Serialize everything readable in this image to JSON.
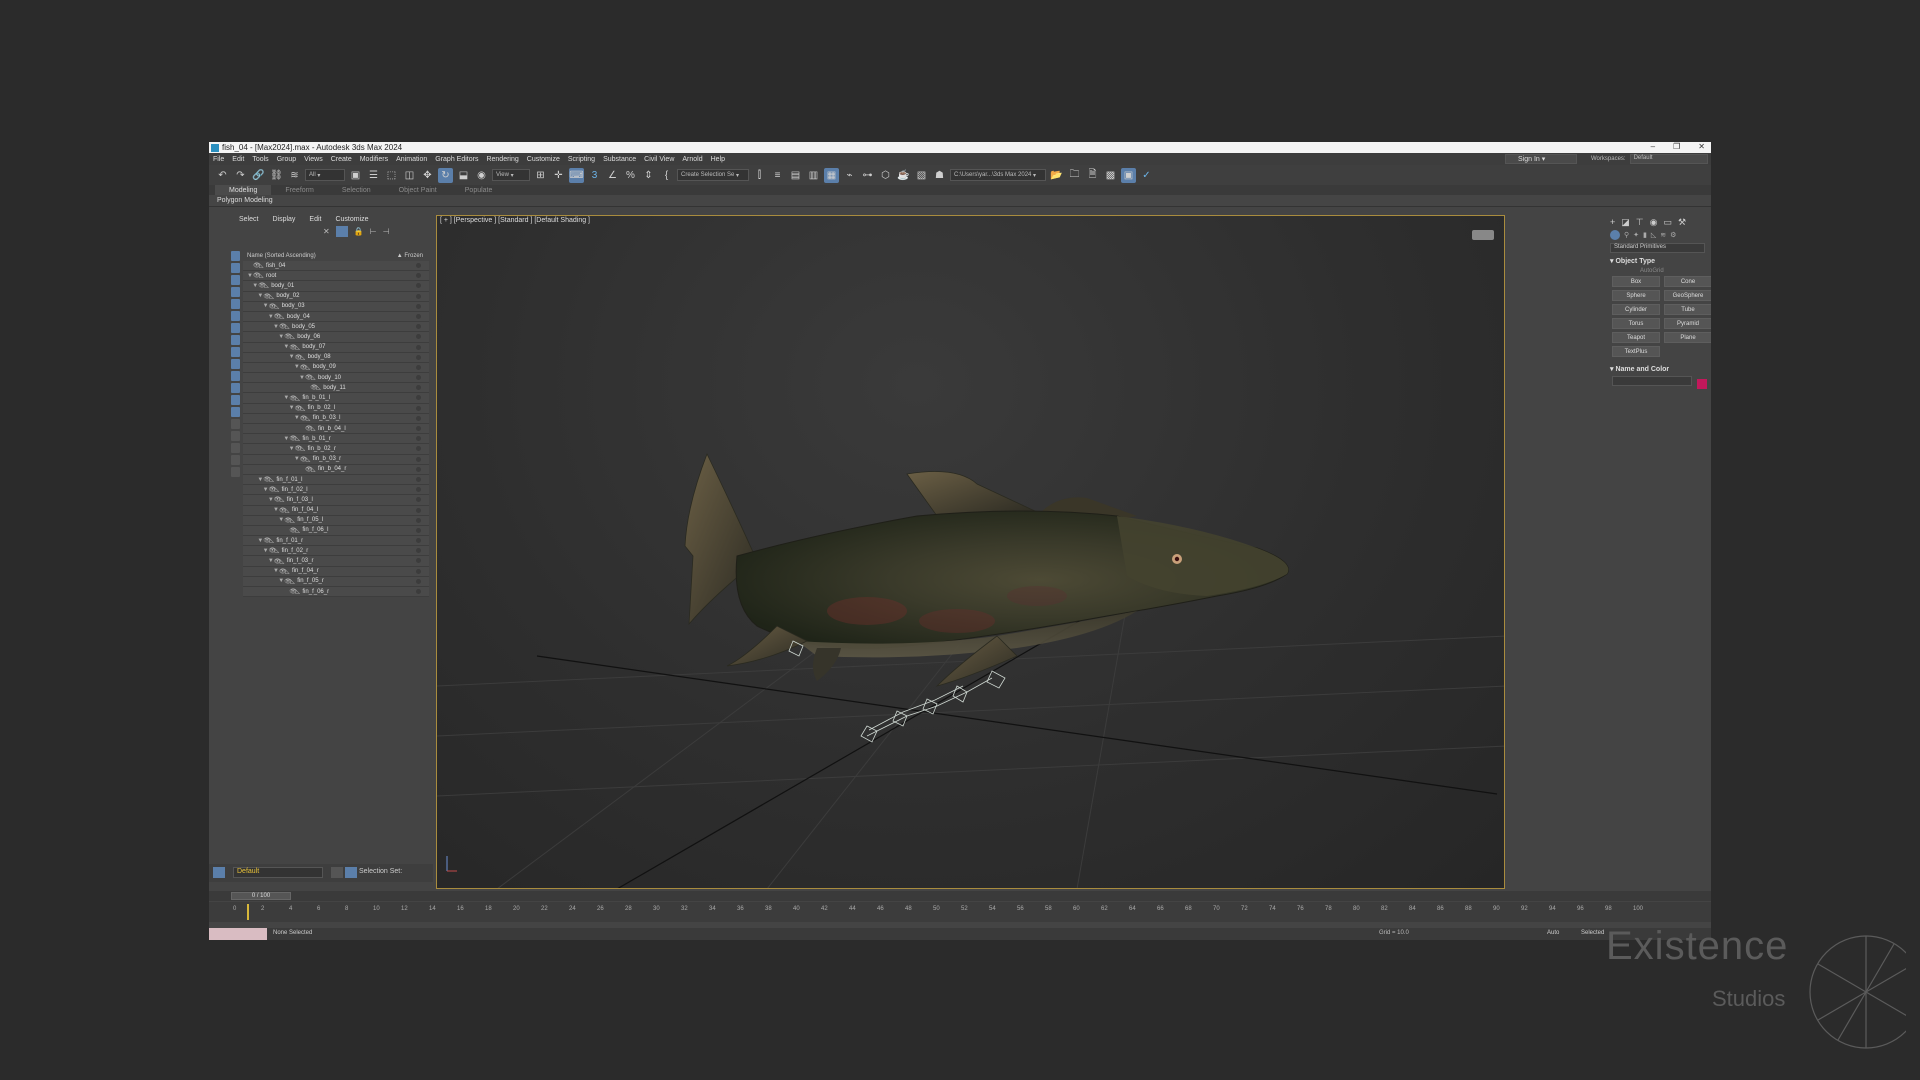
{
  "window": {
    "title": "fish_04 - [Max2024].max - Autodesk 3ds Max 2024",
    "controls": [
      "–",
      "❐",
      "✕"
    ]
  },
  "menu": [
    "File",
    "Edit",
    "Tools",
    "Group",
    "Views",
    "Create",
    "Modifiers",
    "Animation",
    "Graph Editors",
    "Rendering",
    "Customize",
    "Scripting",
    "Substance",
    "Civil View",
    "Arnold",
    "Help"
  ],
  "signin": {
    "label": "Sign In"
  },
  "workspaces": {
    "label": "Workspaces:",
    "value": "Default"
  },
  "toolbar": {
    "filter": "All",
    "view": "View",
    "selection_set": "Create Selection Se",
    "project_path": "C:\\Users\\yar...\\3ds Max 2024"
  },
  "ribbon": {
    "tabs": [
      {
        "label": "Modeling",
        "active": true
      },
      {
        "label": "Freeform"
      },
      {
        "label": "Selection"
      },
      {
        "label": "Object Paint"
      },
      {
        "label": "Populate"
      }
    ],
    "sub": "Polygon Modeling"
  },
  "scene_explorer": {
    "menu": [
      "Select",
      "Display",
      "Edit",
      "Customize"
    ],
    "header_name": "Name (Sorted Ascending)",
    "header_frozen": "▲ Frozen",
    "tree": [
      {
        "name": "fish_04",
        "depth": 0,
        "arrow": ""
      },
      {
        "name": "root",
        "depth": 0,
        "arrow": "▼"
      },
      {
        "name": "body_01",
        "depth": 1,
        "arrow": "▼"
      },
      {
        "name": "body_02",
        "depth": 2,
        "arrow": "▼"
      },
      {
        "name": "body_03",
        "depth": 3,
        "arrow": "▼"
      },
      {
        "name": "body_04",
        "depth": 4,
        "arrow": "▼"
      },
      {
        "name": "body_05",
        "depth": 5,
        "arrow": "▼"
      },
      {
        "name": "body_06",
        "depth": 6,
        "arrow": "▼"
      },
      {
        "name": "body_07",
        "depth": 7,
        "arrow": "▼"
      },
      {
        "name": "body_08",
        "depth": 8,
        "arrow": "▼"
      },
      {
        "name": "body_09",
        "depth": 9,
        "arrow": "▼"
      },
      {
        "name": "body_10",
        "depth": 10,
        "arrow": "▼"
      },
      {
        "name": "body_11",
        "depth": 11,
        "arrow": ""
      },
      {
        "name": "fin_b_01_l",
        "depth": 7,
        "arrow": "▼"
      },
      {
        "name": "fin_b_02_l",
        "depth": 8,
        "arrow": "▼"
      },
      {
        "name": "fin_b_03_l",
        "depth": 9,
        "arrow": "▼"
      },
      {
        "name": "fin_b_04_l",
        "depth": 10,
        "arrow": ""
      },
      {
        "name": "fin_b_01_r",
        "depth": 7,
        "arrow": "▼"
      },
      {
        "name": "fin_b_02_r",
        "depth": 8,
        "arrow": "▼"
      },
      {
        "name": "fin_b_03_r",
        "depth": 9,
        "arrow": "▼"
      },
      {
        "name": "fin_b_04_r",
        "depth": 10,
        "arrow": ""
      },
      {
        "name": "fin_f_01_l",
        "depth": 2,
        "arrow": "▼"
      },
      {
        "name": "fin_f_02_l",
        "depth": 3,
        "arrow": "▼"
      },
      {
        "name": "fin_f_03_l",
        "depth": 4,
        "arrow": "▼"
      },
      {
        "name": "fin_f_04_l",
        "depth": 5,
        "arrow": "▼"
      },
      {
        "name": "fin_f_05_l",
        "depth": 6,
        "arrow": "▼"
      },
      {
        "name": "fin_f_06_l",
        "depth": 7,
        "arrow": ""
      },
      {
        "name": "fin_f_01_r",
        "depth": 2,
        "arrow": "▼"
      },
      {
        "name": "fin_f_02_r",
        "depth": 3,
        "arrow": "▼"
      },
      {
        "name": "fin_f_03_r",
        "depth": 4,
        "arrow": "▼"
      },
      {
        "name": "fin_f_04_r",
        "depth": 5,
        "arrow": "▼"
      },
      {
        "name": "fin_f_05_r",
        "depth": 6,
        "arrow": "▼"
      },
      {
        "name": "fin_f_06_r",
        "depth": 7,
        "arrow": ""
      }
    ],
    "layer": "Default",
    "selection_set_label": "Selection Set:"
  },
  "viewport": {
    "label": "[ + ] [Perspective ] [Standard ] [Default Shading ]"
  },
  "command_panel": {
    "category": "Standard Primitives",
    "object_type_title": "Object Type",
    "autogrid": "AutoGrid",
    "primitives": [
      "Box",
      "Cone",
      "Sphere",
      "GeoSphere",
      "Cylinder",
      "Tube",
      "Torus",
      "Pyramid",
      "Teapot",
      "Plane",
      "TextPlus"
    ],
    "name_color_title": "Name and Color",
    "swatch_color": "#c2185b"
  },
  "timeline": {
    "frame_readout": "0 / 100",
    "ticks": [
      "0",
      "2",
      "4",
      "6",
      "8",
      "10",
      "12",
      "14",
      "16",
      "18",
      "20",
      "22",
      "24",
      "26",
      "28",
      "30",
      "32",
      "34",
      "36",
      "38",
      "40",
      "42",
      "44",
      "46",
      "48",
      "50",
      "52",
      "54",
      "56",
      "58",
      "60",
      "62",
      "64",
      "66",
      "68",
      "70",
      "72",
      "74",
      "76",
      "78",
      "80",
      "82",
      "84",
      "86",
      "88",
      "90",
      "92",
      "94",
      "96",
      "98",
      "100"
    ]
  },
  "status": {
    "message": "None Selected",
    "grid": "Grid = 10.0",
    "auto": "Auto",
    "selected": "Selected"
  },
  "watermark": {
    "title": "Existence",
    "subtitle": "Studios"
  }
}
